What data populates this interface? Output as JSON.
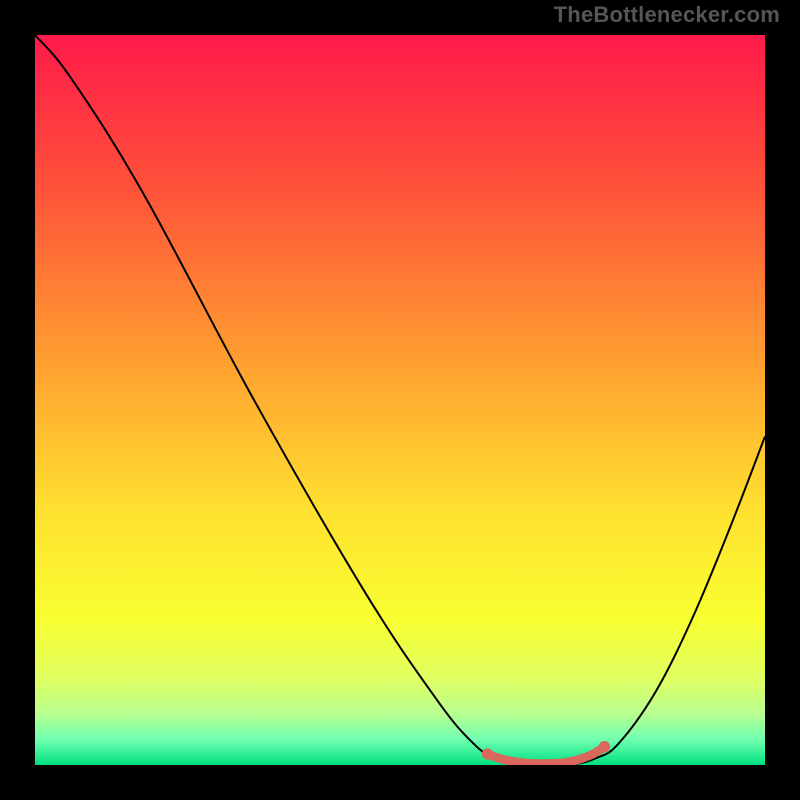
{
  "attribution": "TheBottlenecker.com",
  "chart_data": {
    "type": "line",
    "title": "",
    "xlabel": "",
    "ylabel": "",
    "xlim": [
      0,
      100
    ],
    "ylim": [
      0,
      100
    ],
    "background_gradient": {
      "stops": [
        {
          "offset": 0.0,
          "color": "#ff1a4a"
        },
        {
          "offset": 0.2,
          "color": "#ff4f3a"
        },
        {
          "offset": 0.45,
          "color": "#ffa030"
        },
        {
          "offset": 0.65,
          "color": "#ffe030"
        },
        {
          "offset": 0.8,
          "color": "#f8ff30"
        },
        {
          "offset": 0.88,
          "color": "#e0ff60"
        },
        {
          "offset": 0.93,
          "color": "#b8ff90"
        },
        {
          "offset": 0.965,
          "color": "#70ffb0"
        },
        {
          "offset": 1.0,
          "color": "#00e080"
        }
      ]
    },
    "series": [
      {
        "name": "bottleneck-curve",
        "color": "#000000",
        "points": [
          {
            "x": 0,
            "y": 100
          },
          {
            "x": 5,
            "y": 94
          },
          {
            "x": 15,
            "y": 78
          },
          {
            "x": 30,
            "y": 50
          },
          {
            "x": 45,
            "y": 24
          },
          {
            "x": 55,
            "y": 9
          },
          {
            "x": 60,
            "y": 3
          },
          {
            "x": 63,
            "y": 1
          },
          {
            "x": 67,
            "y": 0
          },
          {
            "x": 73,
            "y": 0
          },
          {
            "x": 77,
            "y": 1
          },
          {
            "x": 80,
            "y": 3
          },
          {
            "x": 85,
            "y": 10
          },
          {
            "x": 90,
            "y": 20
          },
          {
            "x": 95,
            "y": 32
          },
          {
            "x": 100,
            "y": 45
          }
        ]
      },
      {
        "name": "highlight-segment",
        "color": "#d9675b",
        "width_frac": 0.012,
        "points": [
          {
            "x": 62,
            "y": 1.5
          },
          {
            "x": 64,
            "y": 0.8
          },
          {
            "x": 67,
            "y": 0.3
          },
          {
            "x": 70,
            "y": 0.2
          },
          {
            "x": 73,
            "y": 0.4
          },
          {
            "x": 76,
            "y": 1.3
          },
          {
            "x": 78,
            "y": 2.5
          }
        ],
        "endpoints": [
          {
            "x": 62,
            "y": 1.5
          },
          {
            "x": 78,
            "y": 2.5
          }
        ]
      }
    ]
  }
}
